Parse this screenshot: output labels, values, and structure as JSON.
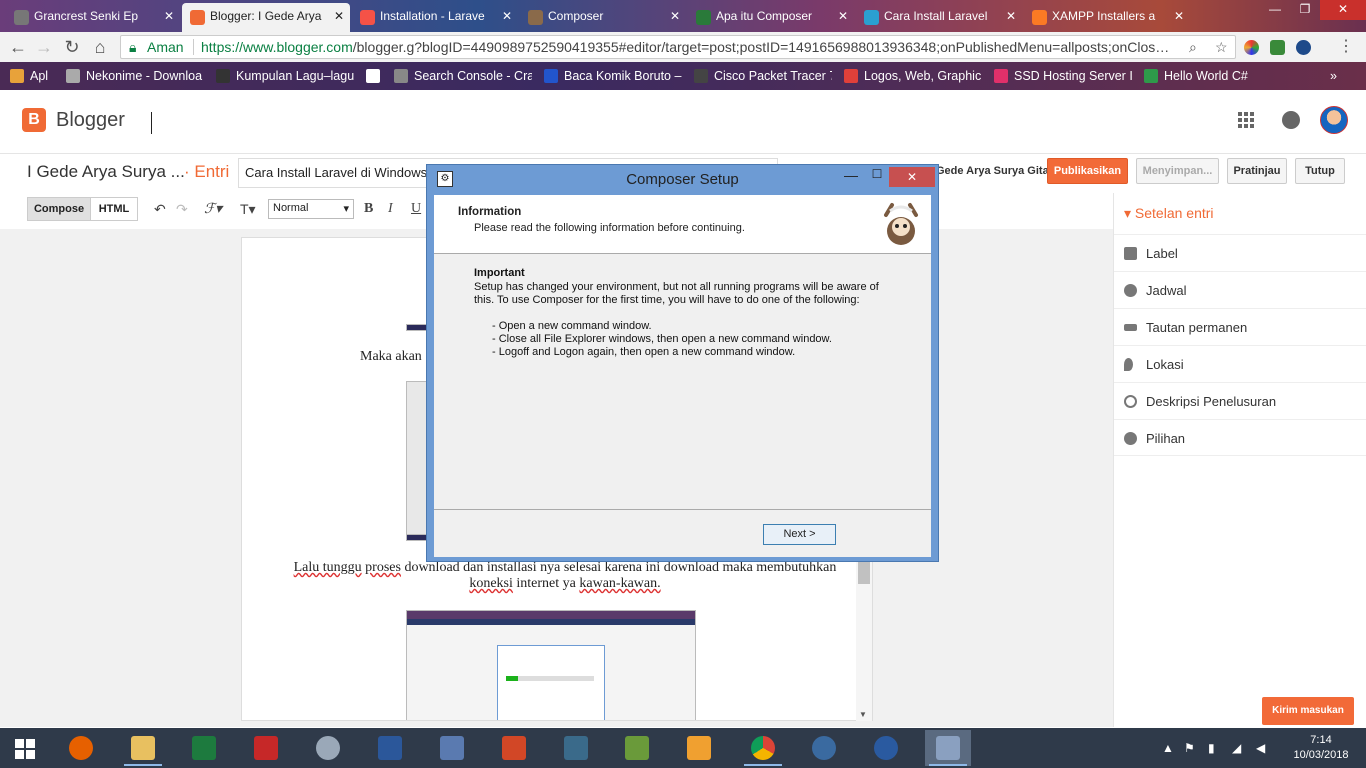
{
  "browser": {
    "tabs": [
      {
        "title": "Grancrest Senki Ep",
        "icon": "anime-favicon",
        "color": "#777777"
      },
      {
        "title": "Blogger: I Gede Arya",
        "icon": "blogger-favicon",
        "color": "#f06a35"
      },
      {
        "title": "Installation - Larave",
        "icon": "laravel-favicon",
        "color": "#f55247"
      },
      {
        "title": "Composer",
        "icon": "composer-favicon",
        "color": "#8a6a4a"
      },
      {
        "title": "Apa itu Composer",
        "icon": "blog-favicon",
        "color": "#2a7a3a"
      },
      {
        "title": "Cara Install Laravel",
        "icon": "m-favicon",
        "color": "#2aa0d0"
      },
      {
        "title": "XAMPP Installers a",
        "icon": "xampp-favicon",
        "color": "#fb7a24"
      }
    ],
    "window_buttons": {
      "minimize": "—",
      "maximize": "❐",
      "close": "✕"
    },
    "security_label": "Aman",
    "url_host": "https://www.blogger.com",
    "url_path": "/blogger.g?blogID=4490989752590419355#editor/target=post;postID=1491656988013936348;onPublishedMenu=allposts;onClos…",
    "bookmarks": [
      {
        "label": "Apl",
        "icon": "apps-icon",
        "color": "#e8a23a"
      },
      {
        "label": "Nekonime - Downloa",
        "icon": "cat-icon",
        "color": "#aaaaaa"
      },
      {
        "label": "Kumpulan Lagu–lagu",
        "icon": "music-icon",
        "color": "#333333"
      },
      {
        "label": "",
        "icon": "page-icon",
        "color": "#ffffff"
      },
      {
        "label": "Search Console - Cra",
        "icon": "search-console-icon",
        "color": "#888888"
      },
      {
        "label": "Baca Komik Boruto –",
        "icon": "c-icon",
        "color": "#2255cc"
      },
      {
        "label": "Cisco Packet Tracer 7",
        "icon": "tracer-icon",
        "color": "#444444"
      },
      {
        "label": "Logos, Web, Graphic",
        "icon": "logos-icon",
        "color": "#e0403a"
      },
      {
        "label": "SSD Hosting Server In",
        "icon": "hosting-icon",
        "color": "#e0306a"
      },
      {
        "label": "Hello World C#",
        "icon": "m-icon",
        "color": "#2e9a4a"
      }
    ],
    "bookmarks_more": "»"
  },
  "blogger": {
    "brand": "Blogger",
    "brand_letter": "B",
    "blog_name": "I Gede Arya Surya ...",
    "entry_label": "· Entri",
    "post_title": "Cara Install Laravel di Windows",
    "author": "Gede Arya Surya Gita",
    "buttons": {
      "publish": "Publikasikan",
      "saving": "Menyimpan...",
      "preview": "Pratinjau",
      "close": "Tutup"
    },
    "toolbar": {
      "compose": "Compose",
      "html": "HTML",
      "format": "Normal",
      "bold": "B",
      "italic": "I",
      "underline": "U"
    },
    "content": {
      "line1": "Maka akan",
      "line2a": "Lalu tunggu",
      "line2b": "proses",
      "line2c": "download dan installasi nya selesai karena ini download maka membutuhkan",
      "line3a": "koneksi",
      "line3b": "internet ya",
      "line3c": "kawan-kawan."
    },
    "settings": {
      "title": "Setelan entri",
      "items": [
        {
          "label": "Label",
          "icon": "label-icon"
        },
        {
          "label": "Jadwal",
          "icon": "clock-icon"
        },
        {
          "label": "Tautan permanen",
          "icon": "link-icon"
        },
        {
          "label": "Lokasi",
          "icon": "location-icon"
        },
        {
          "label": "Deskripsi Penelusuran",
          "icon": "search-icon"
        },
        {
          "label": "Pilihan",
          "icon": "gear-icon"
        }
      ]
    },
    "feedback": "Kirim masukan"
  },
  "dialog": {
    "title": "Composer Setup",
    "header_title": "Information",
    "header_subtitle": "Please read the following information before continuing.",
    "important": "Important",
    "paragraph": "Setup has changed your environment, but not all running programs will be aware of this. To use Composer for the first time, you will have to do one of the following:",
    "bullets": [
      "- Open a new command window.",
      "- Close all File Explorer windows, then open a new command window.",
      "- Logoff and Logon again, then open a new command window."
    ],
    "next_button": "Next >"
  },
  "taskbar": {
    "apps": [
      {
        "name": "firefox",
        "color": "#e66000"
      },
      {
        "name": "file-explorer",
        "color": "#e8c060"
      },
      {
        "name": "excel",
        "color": "#1d7a3e"
      },
      {
        "name": "filezilla",
        "color": "#c62828"
      },
      {
        "name": "paint",
        "color": "#9aa8b8"
      },
      {
        "name": "word",
        "color": "#2b579a"
      },
      {
        "name": "network-tool",
        "color": "#5a7ab0"
      },
      {
        "name": "powerpoint",
        "color": "#d24726"
      },
      {
        "name": "mysql-workbench",
        "color": "#3a6a8a"
      },
      {
        "name": "sketch-tool",
        "color": "#6a9a3a"
      },
      {
        "name": "media-player",
        "color": "#f0a030"
      },
      {
        "name": "chrome",
        "color": "#4a90d9"
      },
      {
        "name": "dolphin-app",
        "color": "#3a6aa0"
      },
      {
        "name": "bird-app",
        "color": "#2a5aa0"
      },
      {
        "name": "composer-setup",
        "color": "#8aa0c0"
      }
    ],
    "time": "7:14",
    "date": "10/03/2018"
  }
}
